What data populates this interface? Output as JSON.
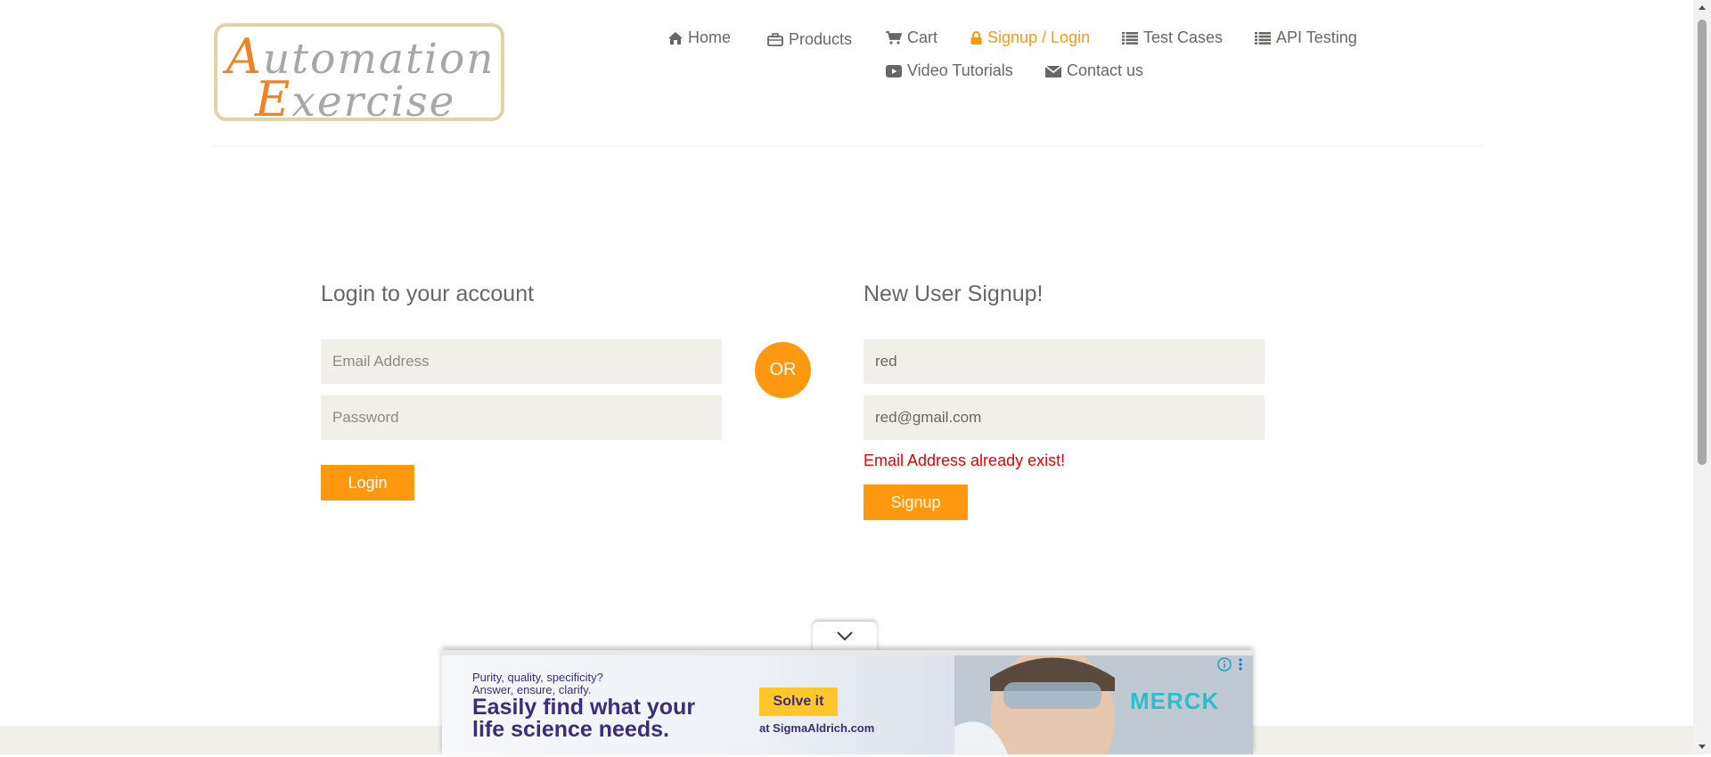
{
  "logo": {
    "line1_cap": "A",
    "line1_rest": "utomation",
    "line2_cap": "E",
    "line2_rest": "xercise"
  },
  "nav": {
    "home": "Home",
    "products": "Products",
    "cart": "Cart",
    "signup_login": "Signup / Login",
    "test_cases": "Test Cases",
    "api_testing": "API Testing",
    "video_tutorials": "Video Tutorials",
    "contact_us": "Contact us"
  },
  "login": {
    "heading": "Login to your account",
    "email_placeholder": "Email Address",
    "password_placeholder": "Password",
    "button": "Login"
  },
  "or_label": "OR",
  "signup": {
    "heading": "New User Signup!",
    "name_value": "red",
    "email_value": "red@gmail.com",
    "error": "Email Address already exist!",
    "button": "Signup"
  },
  "ad": {
    "small_line1": "Purity, quality, specificity?",
    "small_line2": "Answer, ensure, clarify.",
    "big_line1": "Easily find what your",
    "big_line2": "life science needs.",
    "cta": "Solve it",
    "url": "at SigmaAldrich.com",
    "brand": "MERCK"
  },
  "colors": {
    "accent": "#FE980F",
    "error": "#e60000",
    "field_bg": "#F0F0E9",
    "text": "#696763"
  },
  "icons": [
    "home-icon",
    "briefcase-icon",
    "cart-icon",
    "lock-icon",
    "list-icon",
    "list-icon",
    "youtube-icon",
    "envelope-icon",
    "chevron-down-icon",
    "info-icon",
    "more-vertical-icon"
  ]
}
